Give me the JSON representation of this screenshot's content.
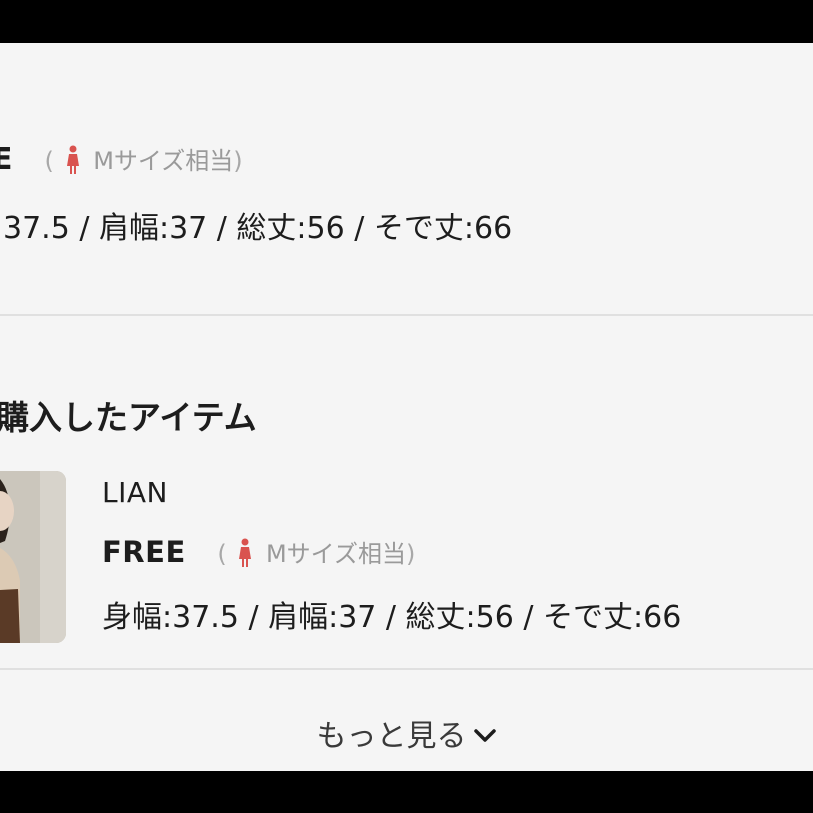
{
  "top_item": {
    "size_code": "E",
    "size_note_open": "(",
    "size_note_text": "Mサイズ相当",
    "size_note_close": ")",
    "measurements": "37.5 / 肩幅:37 / 総丈:56 / そで丈:66"
  },
  "purchased_section": {
    "title": "購入したアイテム",
    "item": {
      "brand": "LIAN",
      "size_code": "FREE",
      "size_note_open": "(",
      "size_note_text": "Mサイズ相当",
      "size_note_close": ")",
      "measurements": "身幅:37.5 / 肩幅:37 / 総丈:56 / そで丈:66"
    }
  },
  "more_button": {
    "label": "もっと見る"
  },
  "colors": {
    "person_icon": "#d9534f",
    "background": "#f5f5f5"
  },
  "icons": {
    "size_person": "person-icon",
    "more_chevron": "chevron-down-icon"
  }
}
